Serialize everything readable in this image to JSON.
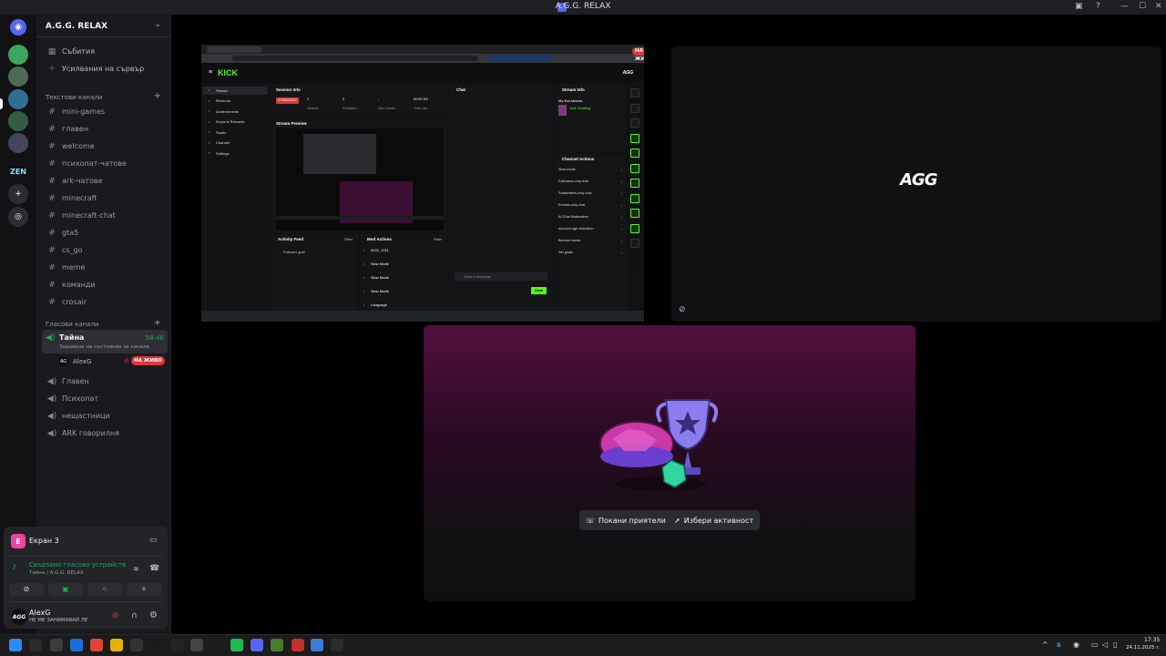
{
  "window": {
    "title": "A.G.G. RELAX",
    "controls": [
      "—",
      "☐",
      "✕"
    ]
  },
  "rail": {
    "servers": [
      {
        "name": "discord-home",
        "glyph": "◉",
        "color": "#5865f2"
      },
      {
        "name": "server-1",
        "glyph": "",
        "color": "#3aa55c"
      },
      {
        "name": "server-2",
        "glyph": "",
        "color": "#4e6a55"
      },
      {
        "name": "server-agg",
        "glyph": "",
        "color": "#2f6f8f"
      },
      {
        "name": "server-4",
        "glyph": "",
        "color": "#335c45"
      },
      {
        "name": "server-5",
        "glyph": "",
        "color": "#44475a"
      },
      {
        "name": "server-zen",
        "glyph": "ZEN",
        "color": "#121214"
      },
      {
        "name": "add-server",
        "glyph": "+",
        "color": "#2b2d31"
      },
      {
        "name": "discover",
        "glyph": "◎",
        "color": "#2b2d31"
      }
    ]
  },
  "sidebar": {
    "server_name": "A.G.G. RELAX",
    "top_items": [
      {
        "icon": "▦",
        "label": "Събития"
      },
      {
        "icon": "✧",
        "label": "Усилвания на сървър"
      }
    ],
    "text_category": "Текстови канали",
    "text_channels": [
      "mini-games",
      "главен",
      "welcome",
      "психопат-чатове",
      "ark-чатове",
      "minecraft",
      "minecraft-chat",
      "gta5",
      "cs_go",
      "meme",
      "команди",
      "crosair"
    ],
    "voice_category": "Гласови канали",
    "active_voice": {
      "name": "Тайна",
      "timer": "58:46",
      "status": "Задаване на състояние за канала",
      "user": "AlexG",
      "live_badge": "НА ЖИВО"
    },
    "voice_channels": [
      "Главен",
      "Психопат",
      "нещастници",
      "ARK говорилня"
    ]
  },
  "panel": {
    "stream_name": "Екран 3",
    "connection_status": "Свързано гласово устройств",
    "connection_location": "Тайна / A.G.G. RELAX",
    "user": {
      "name": "AlexG",
      "status": "НЕ МЕ ЗАНИМАВАЙ ЛЕ"
    }
  },
  "stage": {
    "live_badge": "НА ЖИВО",
    "agg_label": "AGG",
    "invite_button": "Покани приятели",
    "activity_button": "Избери активност"
  },
  "kick": {
    "logo": "KICK",
    "nav": [
      "Stream",
      "Revenue",
      "Achievements",
      "Drops & Rewards",
      "Studio",
      "Channel",
      "Settings"
    ],
    "session_title": "Session Info",
    "session_badge": "STREAMING",
    "stats": [
      {
        "value": "1",
        "label": "Viewers"
      },
      {
        "value": "2",
        "label": "Followers"
      },
      {
        "value": "-",
        "label": "Sub Counts"
      },
      {
        "value": "00:57:53",
        "label": "Time Live"
      }
    ],
    "chat_title": "Chat",
    "stream_info_title": "Stream Info",
    "stream_title": "My first stream.",
    "category": "Just Chatting",
    "channel_actions_title": "Channel Actions",
    "actions": [
      "Slow mode",
      "Followers-only chat",
      "Subscribers-only chat",
      "Emotes-only chat",
      "AI Chat Moderation",
      "Account age restriction",
      "Banned words",
      "Set goals"
    ],
    "preview_title": "Stream Preview",
    "activity_title": "Activity Feed",
    "activity_item": "Follower goal",
    "mod_title": "Mod Actions",
    "mod_items": [
      "AGG_1011",
      "Slow Mode",
      "Slow Mode",
      "Slow Mode",
      "Language"
    ],
    "chat_placeholder": "Send a message",
    "chat_button": "Chat",
    "filter": "Filter"
  },
  "taskbar": {
    "time": "17:35",
    "date": "24.11.2025 г."
  },
  "colors": {
    "accent": "#5865f2",
    "live": "#da373c",
    "kick_green": "#53fc18",
    "voice_green": "#23a55a"
  }
}
